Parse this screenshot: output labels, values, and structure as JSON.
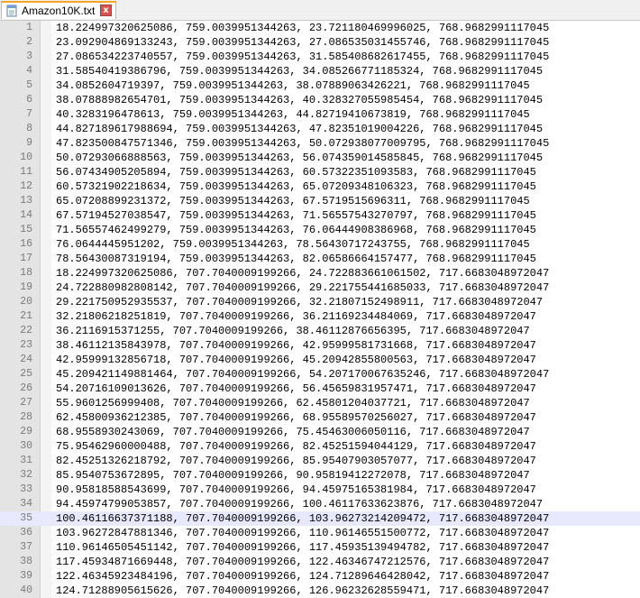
{
  "tab": {
    "title": "Amazon10K.txt",
    "close_glyph": "x",
    "icon": "notepad-file-icon",
    "accent": "#f5a623"
  },
  "current_line": 35,
  "lines": [
    "18.224997320625086, 759.0039951344263, 23.721180469996025, 768.9682991117045",
    "23.092904869133243, 759.0039951344263, 27.086535031455746, 768.9682991117045",
    "27.086534223740557, 759.0039951344263, 31.585408682617455, 768.9682991117045",
    "31.58540419386796, 759.0039951344263, 34.085266771185324, 768.9682991117045",
    "34.0852604719397, 759.0039951344263, 38.07889063426221, 768.9682991117045",
    "38.07888982654701, 759.0039951344263, 40.328327055985454, 768.9682991117045",
    "40.3283196478613, 759.0039951344263, 44.82719410673819, 768.9682991117045",
    "44.827189617988694, 759.0039951344263, 47.82351019004226, 768.9682991117045",
    "47.823500847571346, 759.0039951344263, 50.072938077009795, 768.9682991117045",
    "50.07293066888563, 759.0039951344263, 56.074359014585845, 768.9682991117045",
    "56.07434905205894, 759.0039951344263, 60.57322351093583, 768.9682991117045",
    "60.57321902218634, 759.0039951344263, 65.07209348106323, 768.9682991117045",
    "65.07208899231372, 759.0039951344263, 67.5719515696311, 768.9682991117045",
    "67.57194527038547, 759.0039951344263, 71.56557543270797, 768.9682991117045",
    "71.56557462499279, 759.0039951344263, 76.06444908386968, 768.9682991117045",
    "76.0644445951202, 759.0039951344263, 78.56430717243755, 768.9682991117045",
    "78.56430087319194, 759.0039951344263, 82.06586664157477, 768.9682991117045",
    "18.224997320625086, 707.7040009199266, 24.722883661061502, 717.6683048972047",
    "24.722880982808142, 707.7040009199266, 29.221755441685033, 717.6683048972047",
    "29.221750952935537, 707.7040009199266, 32.21807152498911, 717.6683048972047",
    "32.21806218251819, 707.7040009199266, 36.21169234484069, 717.6683048972047",
    "36.2116915371255, 707.7040009199266, 38.46112876656395, 717.6683048972047",
    "38.46112135843978, 707.7040009199266, 42.95999581731668, 717.6683048972047",
    "42.95999132856718, 707.7040009199266, 45.20942855800563, 717.6683048972047",
    "45.209421149881464, 707.7040009199266, 54.207170067635246, 717.6683048972047",
    "54.20716109013626, 707.7040009199266, 56.45659831957471, 717.6683048972047",
    "55.9601256999408, 707.7040009199266, 62.45801204037721, 717.6683048972047",
    "62.45800936212385, 707.7040009199266, 68.95589570256027, 717.6683048972047",
    "68.9558930243069, 707.7040009199266, 75.45463006050116, 717.6683048972047",
    "75.95462960000488, 707.7040009199266, 82.45251594044129, 717.6683048972047",
    "82.45251326218792, 707.7040009199266, 85.95407903057077, 717.6683048972047",
    "85.9540753672895, 707.7040009199266, 90.95819412272078, 717.6683048972047",
    "90.95818588543699, 707.7040009199266, 94.45975165381984, 717.6683048972047",
    "94.45974799053857, 707.7040009199266, 100.46117633623876, 717.6683048972047",
    "100.46116637371188, 707.7040009199266, 103.96273214209472, 717.6683048972047",
    "103.96272847881346, 707.7040009199266, 110.96146551500772, 717.6683048972047",
    "110.96146505451142, 707.7040009199266, 117.45935139494782, 717.6683048972047",
    "117.45934871669448, 707.7040009199266, 122.46346747212576, 717.6683048972047",
    "122.46345923484196, 707.7040009199266, 124.71289646428042, 717.6683048972047",
    "124.71288905615626, 707.7040009199266, 126.96232628559471, 717.6683048972047"
  ]
}
